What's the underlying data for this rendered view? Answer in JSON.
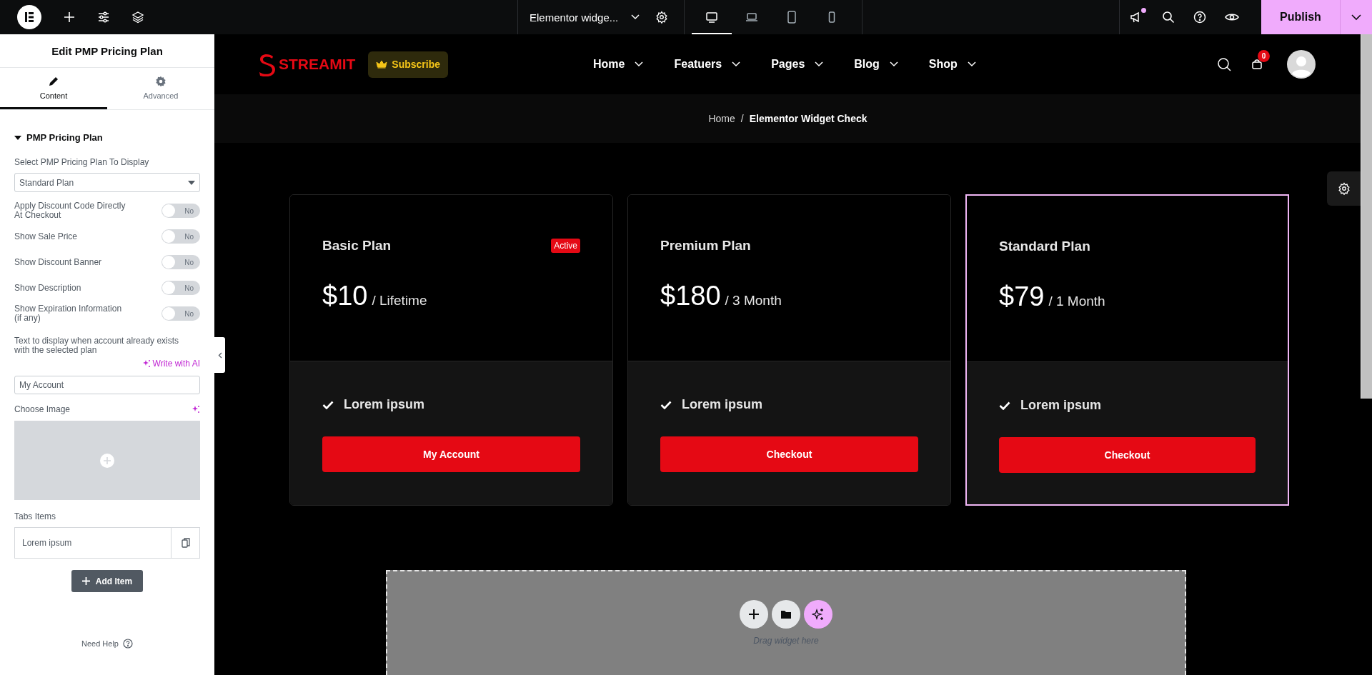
{
  "topbar": {
    "document_title": "Elementor widge...",
    "devices": [
      {
        "kind": "desktop",
        "selected": true
      },
      {
        "kind": "laptop",
        "selected": false
      },
      {
        "kind": "tablet",
        "selected": false
      },
      {
        "kind": "mobile",
        "selected": false
      }
    ],
    "notification": true,
    "publish": "Publish"
  },
  "panel": {
    "title": "Edit PMP Pricing Plan",
    "tabs": [
      {
        "kind": "content",
        "label": "Content",
        "selected": true
      },
      {
        "kind": "advanced",
        "label": "Advanced",
        "selected": false
      }
    ],
    "section": {
      "title": "PMP Pricing Plan",
      "expanded": true
    },
    "select": {
      "label": "Select PMP Pricing Plan To Display",
      "value": "Standard Plan"
    },
    "toggles": [
      {
        "label": "Apply Discount Code Directly At Checkout",
        "state_text": "No",
        "on": false
      },
      {
        "label": "Show Sale Price",
        "state_text": "No",
        "on": false
      },
      {
        "label": "Show Discount Banner",
        "state_text": "No",
        "on": false
      },
      {
        "label": "Show Description",
        "state_text": "No",
        "on": false
      },
      {
        "label": "Show Expiration Information (if any)",
        "state_text": "No",
        "on": false
      }
    ],
    "account_text": {
      "label": "Text to display when account already exists with the selected plan",
      "ai_link": "Write with AI",
      "value": "My Account"
    },
    "image": {
      "label": "Choose Image"
    },
    "repeater": {
      "label": "Tabs Items",
      "items": [
        "Lorem ipsum"
      ],
      "add_button": "Add Item"
    },
    "help": "Need Help"
  },
  "site": {
    "brand": "STREAMIT",
    "subscribe": "Subscribe",
    "nav": [
      "Home",
      "Featuers",
      "Pages",
      "Blog",
      "Shop"
    ],
    "cart_count": "0",
    "breadcrumb": [
      "Home",
      "Elementor Widget Check"
    ],
    "breadcrumb_separator": "/",
    "plans": [
      {
        "name": "Basic Plan",
        "active": true,
        "active_text": "Active",
        "price": "$10",
        "period": "/ Lifetime",
        "feature": "Lorem ipsum",
        "button": "My Account",
        "selected": false
      },
      {
        "name": "Premium Plan",
        "active": false,
        "price": "$180",
        "period": "/ 3 Month",
        "feature": "Lorem ipsum",
        "button": "Checkout",
        "selected": false
      },
      {
        "name": "Standard Plan",
        "active": false,
        "price": "$79",
        "period": "/ 1 Month",
        "feature": "Lorem ipsum",
        "button": "Checkout",
        "selected": true
      }
    ],
    "drop_zone": {
      "hint": "Drag widget here"
    }
  }
}
